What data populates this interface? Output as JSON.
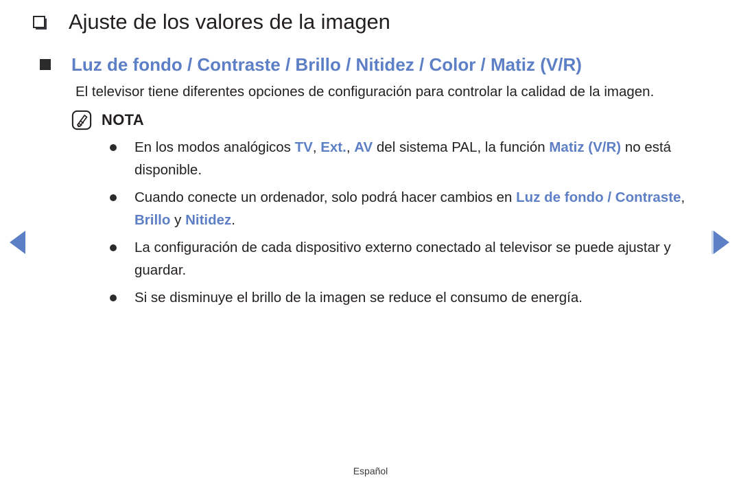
{
  "page": {
    "title": "Ajuste de los valores de la imagen",
    "subtitle": "Luz de fondo / Contraste / Brillo / Nitidez / Color / Matiz (V/R)",
    "intro_paragraph": "El televisor tiene diferentes opciones de configuración para controlar la calidad de la imagen.",
    "footer_language": "Español"
  },
  "note": {
    "label": "NOTA",
    "icon": "note-pen-icon",
    "items": [
      {
        "parts": [
          {
            "text": "En los modos analógicos ",
            "highlight": false
          },
          {
            "text": "TV",
            "highlight": true
          },
          {
            "text": ", ",
            "highlight": false
          },
          {
            "text": "Ext.",
            "highlight": true
          },
          {
            "text": ", ",
            "highlight": false
          },
          {
            "text": "AV",
            "highlight": true
          },
          {
            "text": " del sistema PAL, la función ",
            "highlight": false
          },
          {
            "text": "Matiz (V/R)",
            "highlight": true
          },
          {
            "text": " no está disponible.",
            "highlight": false
          }
        ]
      },
      {
        "parts": [
          {
            "text": "Cuando conecte un ordenador, solo podrá hacer cambios en ",
            "highlight": false
          },
          {
            "text": "Luz de fondo / Contraste",
            "highlight": true
          },
          {
            "text": ", ",
            "highlight": false
          },
          {
            "text": "Brillo",
            "highlight": true
          },
          {
            "text": " y ",
            "highlight": false
          },
          {
            "text": "Nitidez",
            "highlight": true
          },
          {
            "text": ".",
            "highlight": false
          }
        ]
      },
      {
        "parts": [
          {
            "text": "La configuración de cada dispositivo externo conectado al televisor se puede ajustar y guardar.",
            "highlight": false
          }
        ]
      },
      {
        "parts": [
          {
            "text": "Si se disminuye el brillo de la imagen se reduce el consumo de energía.",
            "highlight": false
          }
        ]
      }
    ]
  },
  "navigation": {
    "previous_label": "◀",
    "next_label": "▶"
  },
  "colors": {
    "accent_blue": "#5d7fc6",
    "text_dark": "#231f20",
    "background": "#ffffff"
  },
  "icons": {
    "title_bullet": "hollow-square-icon",
    "subtitle_bullet": "filled-square-icon",
    "list_bullet": "round-dot-icon"
  }
}
